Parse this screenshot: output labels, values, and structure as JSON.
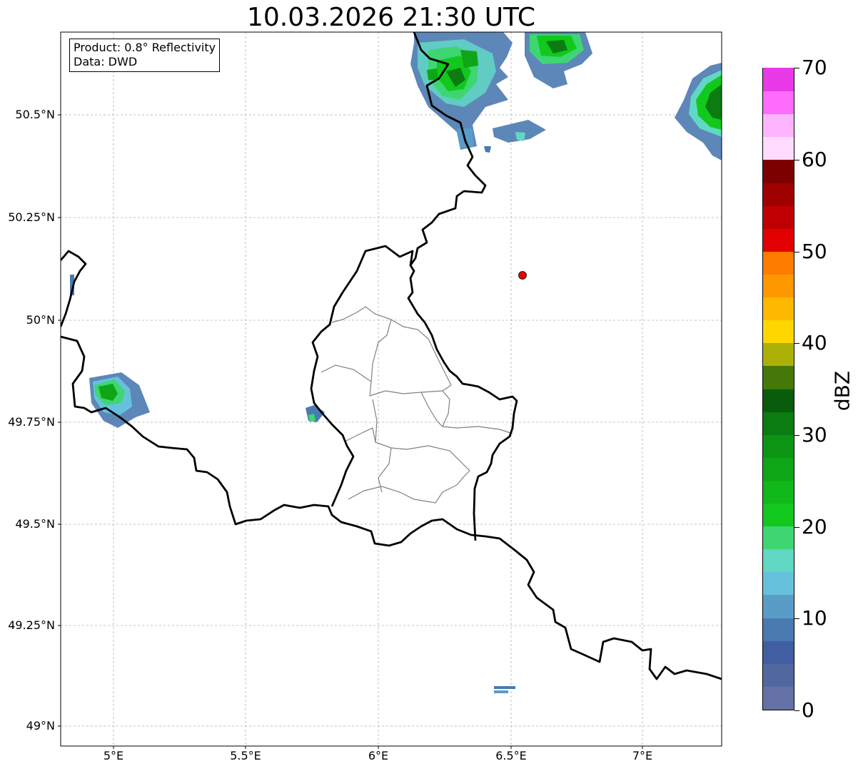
{
  "title": "10.03.2026 21:30 UTC",
  "info_box": {
    "product": "Product: 0.8° Reflectivity",
    "data": "Data: DWD"
  },
  "axes": {
    "lat_labels": [
      "50.5°N",
      "50.25°N",
      "50°N",
      "49.75°N",
      "49.5°N",
      "49.25°N",
      "49°N"
    ],
    "lon_labels": [
      "5°E",
      "5.5°E",
      "6°E",
      "6.5°E",
      "7°E"
    ]
  },
  "colorbar": {
    "label": "dBZ",
    "ticks": [
      "0",
      "10",
      "20",
      "30",
      "40",
      "50",
      "60",
      "70"
    ],
    "colors": [
      "#6472a8",
      "#51689f",
      "#425ea2",
      "#4a7ab0",
      "#5a9cc8",
      "#66c2dc",
      "#60d8c4",
      "#3ed672",
      "#12c81c",
      "#10b81a",
      "#0ea616",
      "#0c9414",
      "#0a7c12",
      "#085c0c",
      "#447808",
      "#acb006",
      "#fed600",
      "#feb800",
      "#fe9800",
      "#fe7c00",
      "#e20000",
      "#c00000",
      "#a00000",
      "#7c0000",
      "#ffdcff",
      "#ffb4ff",
      "#fe6cfe",
      "#e83ae8"
    ]
  },
  "colors": {
    "border": "#000000",
    "districts": "#808080",
    "grid": "#b0b0b0",
    "radar_site": "#ee0000"
  }
}
